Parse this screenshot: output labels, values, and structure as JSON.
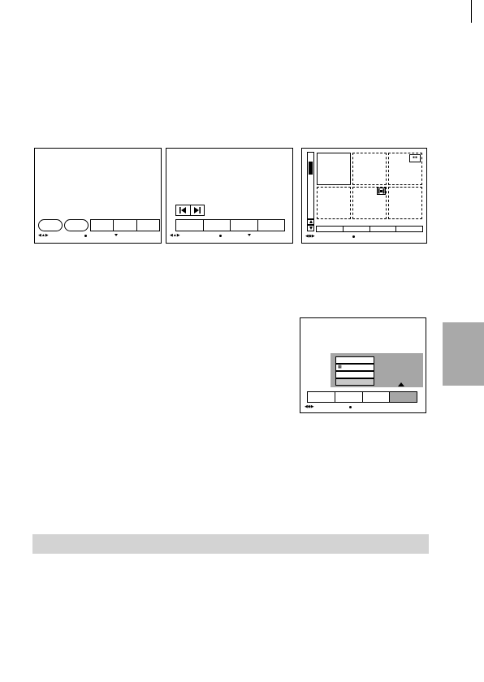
{
  "page": {
    "background": "#ffffff",
    "line_color": "#000000",
    "highlight_gray": "#a6a6a6",
    "section_bar_color": "#d3d3d3",
    "side_tab_color": "#a9a9a9"
  },
  "screens": [
    {
      "id": "screen-1",
      "buttons": [
        "oval-button",
        "oval-button",
        "tab",
        "tab",
        "tab"
      ],
      "footer_icons": [
        "left-up-right-arrows-icon",
        "dot-icon",
        "down-triangle-icon"
      ]
    },
    {
      "id": "screen-2",
      "skip_controls": [
        "skip-previous-icon",
        "skip-next-icon"
      ],
      "footer_icons": [
        "left-up-right-arrows-icon",
        "dot-icon",
        "down-triangle-icon"
      ]
    },
    {
      "id": "screen-3-index",
      "grid": "3x2 thumbnails",
      "thumbnail_icons": [
        "protect-icon",
        "movie-icon"
      ],
      "footer_icons": [
        "four-way-arrows-icon",
        "dot-icon"
      ]
    },
    {
      "id": "screen-4-menu",
      "menu_items": [
        "",
        "",
        "",
        ""
      ],
      "selected_tab_index": 3,
      "footer_icons": [
        "four-way-arrows-icon",
        "dot-icon"
      ]
    }
  ]
}
